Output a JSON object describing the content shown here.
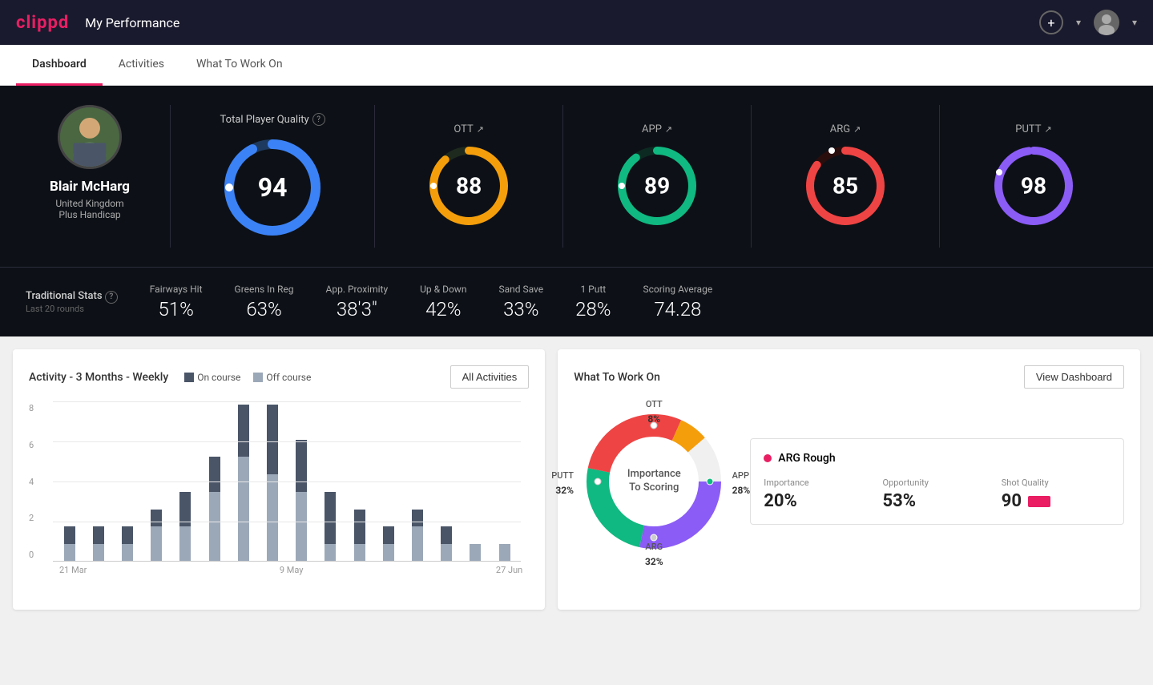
{
  "header": {
    "logo": "clippd",
    "title": "My Performance",
    "add_icon": "⊕",
    "chevron_icon": "▾"
  },
  "nav": {
    "tabs": [
      {
        "label": "Dashboard",
        "active": true
      },
      {
        "label": "Activities",
        "active": false
      },
      {
        "label": "What To Work On",
        "active": false
      }
    ]
  },
  "player": {
    "name": "Blair McHarg",
    "country": "United Kingdom",
    "handicap": "Plus Handicap"
  },
  "total_quality": {
    "label": "Total Player Quality",
    "value": 94,
    "color": "#3b82f6"
  },
  "scores": [
    {
      "label": "OTT",
      "value": 88,
      "color": "#f59e0b"
    },
    {
      "label": "APP",
      "value": 89,
      "color": "#10b981"
    },
    {
      "label": "ARG",
      "value": 85,
      "color": "#ef4444"
    },
    {
      "label": "PUTT",
      "value": 98,
      "color": "#8b5cf6"
    }
  ],
  "traditional_stats": {
    "title": "Traditional Stats",
    "period": "Last 20 rounds",
    "stats": [
      {
        "name": "Fairways Hit",
        "value": "51%"
      },
      {
        "name": "Greens In Reg",
        "value": "63%"
      },
      {
        "name": "App. Proximity",
        "value": "38'3\""
      },
      {
        "name": "Up & Down",
        "value": "42%"
      },
      {
        "name": "Sand Save",
        "value": "33%"
      },
      {
        "name": "1 Putt",
        "value": "28%"
      },
      {
        "name": "Scoring Average",
        "value": "74.28"
      }
    ]
  },
  "activity_chart": {
    "title": "Activity - 3 Months - Weekly",
    "legend_on_course": "On course",
    "legend_off_course": "Off course",
    "all_activities_btn": "All Activities",
    "color_on_course": "#4a5568",
    "color_off_course": "#9ba8b8",
    "y_labels": [
      "0",
      "2",
      "4",
      "6",
      "8"
    ],
    "x_labels": [
      "21 Mar",
      "",
      "9 May",
      "",
      "27 Jun"
    ],
    "bars": [
      {
        "on": 1,
        "off": 1
      },
      {
        "on": 1,
        "off": 1
      },
      {
        "on": 1,
        "off": 1
      },
      {
        "on": 1,
        "off": 2
      },
      {
        "on": 2,
        "off": 2
      },
      {
        "on": 2,
        "off": 4
      },
      {
        "on": 3,
        "off": 6
      },
      {
        "on": 4,
        "off": 5
      },
      {
        "on": 3,
        "off": 4
      },
      {
        "on": 3,
        "off": 1
      },
      {
        "on": 2,
        "off": 1
      },
      {
        "on": 1,
        "off": 1
      },
      {
        "on": 1,
        "off": 2
      },
      {
        "on": 1,
        "off": 1
      },
      {
        "on": 0,
        "off": 1
      },
      {
        "on": 0,
        "off": 1
      }
    ]
  },
  "what_to_work_on": {
    "title": "What To Work On",
    "view_dashboard_btn": "View Dashboard",
    "donut_label_line1": "Importance",
    "donut_label_line2": "To Scoring",
    "segments": [
      {
        "label": "OTT",
        "pct": "8%",
        "color": "#f59e0b"
      },
      {
        "label": "APP",
        "pct": "28%",
        "color": "#10b981"
      },
      {
        "label": "ARG",
        "pct": "32%",
        "color": "#ef4444"
      },
      {
        "label": "PUTT",
        "pct": "32%",
        "color": "#8b5cf6"
      }
    ],
    "info_card": {
      "title": "ARG Rough",
      "importance_label": "Importance",
      "importance_value": "20%",
      "opportunity_label": "Opportunity",
      "opportunity_value": "53%",
      "shot_quality_label": "Shot Quality",
      "shot_quality_value": "90"
    }
  }
}
